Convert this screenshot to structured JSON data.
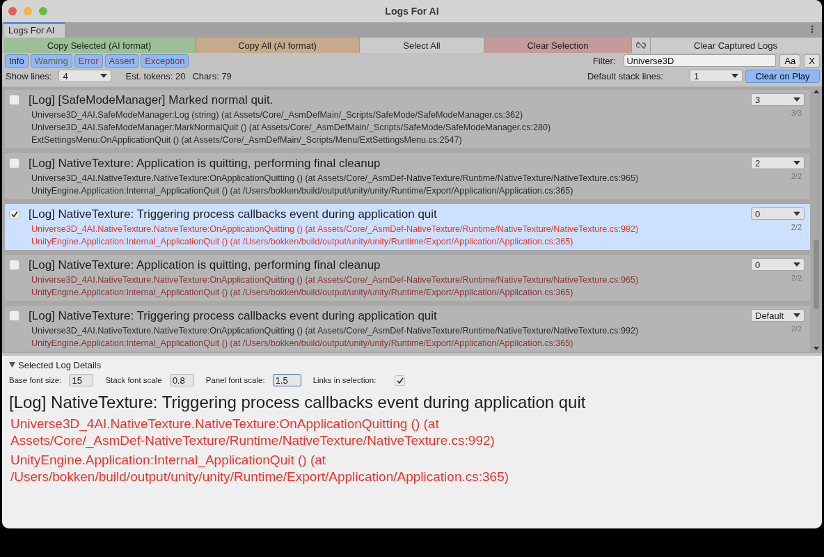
{
  "window": {
    "title": "Logs For AI"
  },
  "tabs": [
    {
      "label": "Logs For AI",
      "selected": true
    }
  ],
  "toolbar": {
    "buttons": [
      {
        "kind": "text",
        "label": "Copy Selected (AI format)",
        "color": "#9dbf97"
      },
      {
        "kind": "text",
        "label": "Copy All (AI format)",
        "color": "#c5ab8b"
      },
      {
        "kind": "text",
        "label": "Select All",
        "color": "#cbcbcb"
      },
      {
        "kind": "text",
        "label": "Clear Selection",
        "color": "#c49b9a"
      },
      {
        "kind": "icon",
        "color": "#cbcbcb"
      },
      {
        "kind": "text",
        "label": "Clear Captured Logs",
        "color": "#cbcbcb"
      }
    ]
  },
  "filters": [
    {
      "label": "Info",
      "on": true,
      "kind": "info"
    },
    {
      "label": "Warning",
      "on": true,
      "kind": "warning"
    },
    {
      "label": "Error",
      "on": true,
      "kind": "error"
    },
    {
      "label": "Assert",
      "on": true,
      "kind": "assert"
    },
    {
      "label": "Exception",
      "on": true,
      "kind": "exception"
    }
  ],
  "filter": {
    "label": "Filter:",
    "value": "Universe3D",
    "case_button": "Aa",
    "clear_button": "X"
  },
  "show_lines": {
    "label": "Show lines:",
    "value": "4"
  },
  "stats": [
    "Est. tokens: 20",
    "Chars: 79"
  ],
  "default_stack_lines": {
    "label": "Default stack lines:",
    "value": "1"
  },
  "clear_on_play": {
    "label": "Clear on Play",
    "on": true
  },
  "logs": [
    {
      "checked": false,
      "selected": false,
      "message": "[Log] [SafeModeManager] Marked normal quit.",
      "lines": "3",
      "count": "3/3",
      "stack": [
        {
          "kind": "normal",
          "text": "Universe3D_4AI.SafeModeManager:Log (string) (at Assets/Core/_AsmDefMain/_Scripts/SafeMode/SafeModeManager.cs:362)"
        },
        {
          "kind": "normal",
          "text": "Universe3D_4AI.SafeModeManager:MarkNormalQuit () (at Assets/Core/_AsmDefMain/_Scripts/SafeMode/SafeModeManager.cs:280)"
        },
        {
          "kind": "normal",
          "text": "ExtSettingsMenu:OnApplicationQuit () (at Assets/Core/_AsmDefMain/_Scripts/Menu/ExtSettingsMenu.cs:2547)"
        }
      ]
    },
    {
      "checked": false,
      "selected": false,
      "message": "[Log] NativeTexture: Application is quitting, performing final cleanup",
      "lines": "2",
      "count": "2/2",
      "stack": [
        {
          "kind": "normal",
          "text": "Universe3D_4AI.NativeTexture.NativeTexture:OnApplicationQuitting () (at Assets/Core/_AsmDef-NativeTexture/Runtime/NativeTexture/NativeTexture.cs:965)"
        },
        {
          "kind": "normal",
          "text": "UnityEngine.Application:Internal_ApplicationQuit () (at /Users/bokken/build/output/unity/unity/Runtime/Export/Application/Application.cs:365)"
        }
      ]
    },
    {
      "checked": true,
      "selected": true,
      "message": "[Log] NativeTexture: Triggering process callbacks event during application quit",
      "lines": "0",
      "count": "2/2",
      "stack": [
        {
          "kind": "error",
          "text": "Universe3D_4AI.NativeTexture.NativeTexture:OnApplicationQuitting () (at Assets/Core/_AsmDef-NativeTexture/Runtime/NativeTexture/NativeTexture.cs:992)"
        },
        {
          "kind": "error",
          "text": "UnityEngine.Application:Internal_ApplicationQuit () (at /Users/bokken/build/output/unity/unity/Runtime/Export/Application/Application.cs:365)"
        }
      ]
    },
    {
      "checked": false,
      "selected": false,
      "message": "[Log] NativeTexture: Application is quitting, performing final cleanup",
      "lines": "0",
      "count": "2/2",
      "stack": [
        {
          "kind": "error",
          "text": "Universe3D_4AI.NativeTexture.NativeTexture:OnApplicationQuitting () (at Assets/Core/_AsmDef-NativeTexture/Runtime/NativeTexture/NativeTexture.cs:965)"
        },
        {
          "kind": "error",
          "text": "UnityEngine.Application:Internal_ApplicationQuit () (at /Users/bokken/build/output/unity/unity/Runtime/Export/Application/Application.cs:365)"
        }
      ]
    },
    {
      "checked": false,
      "selected": false,
      "message": "[Log] NativeTexture: Triggering process callbacks event during application quit",
      "lines": "Default",
      "count": "2/2",
      "stack": [
        {
          "kind": "normal",
          "text": "Universe3D_4AI.NativeTexture.NativeTexture:OnApplicationQuitting () (at Assets/Core/_AsmDef-NativeTexture/Runtime/NativeTexture/NativeTexture.cs:992)"
        },
        {
          "kind": "error",
          "text": "UnityEngine.Application:Internal_ApplicationQuit () (at /Users/bokken/build/output/unity/unity/Runtime/Export/Application/Application.cs:365)"
        }
      ]
    }
  ],
  "details": {
    "title": "Selected Log Details",
    "expanded": true,
    "fields": [
      {
        "kind": "input",
        "label": "Base font size:",
        "value": "15",
        "focused": false
      },
      {
        "kind": "input",
        "label": "Stack font scale",
        "value": "0.8",
        "focused": false
      },
      {
        "kind": "input",
        "label": "Panel font scale:",
        "value": "1.5",
        "focused": true
      },
      {
        "kind": "checkbox",
        "label": "Links in selection:",
        "checked": true
      }
    ],
    "message": "[Log] NativeTexture: Triggering process callbacks event during application quit",
    "stack": [
      {
        "kind": "error",
        "text": "Universe3D_4AI.NativeTexture.NativeTexture:OnApplicationQuitting () (at Assets/Core/_AsmDef-NativeTexture/Runtime/NativeTexture/NativeTexture.cs:992)"
      },
      {
        "kind": "error",
        "text": "UnityEngine.Application:Internal_ApplicationQuit () (at /Users/bokken/build/output/unity/unity/Runtime/Export/Application/Application.cs:365)"
      }
    ]
  }
}
